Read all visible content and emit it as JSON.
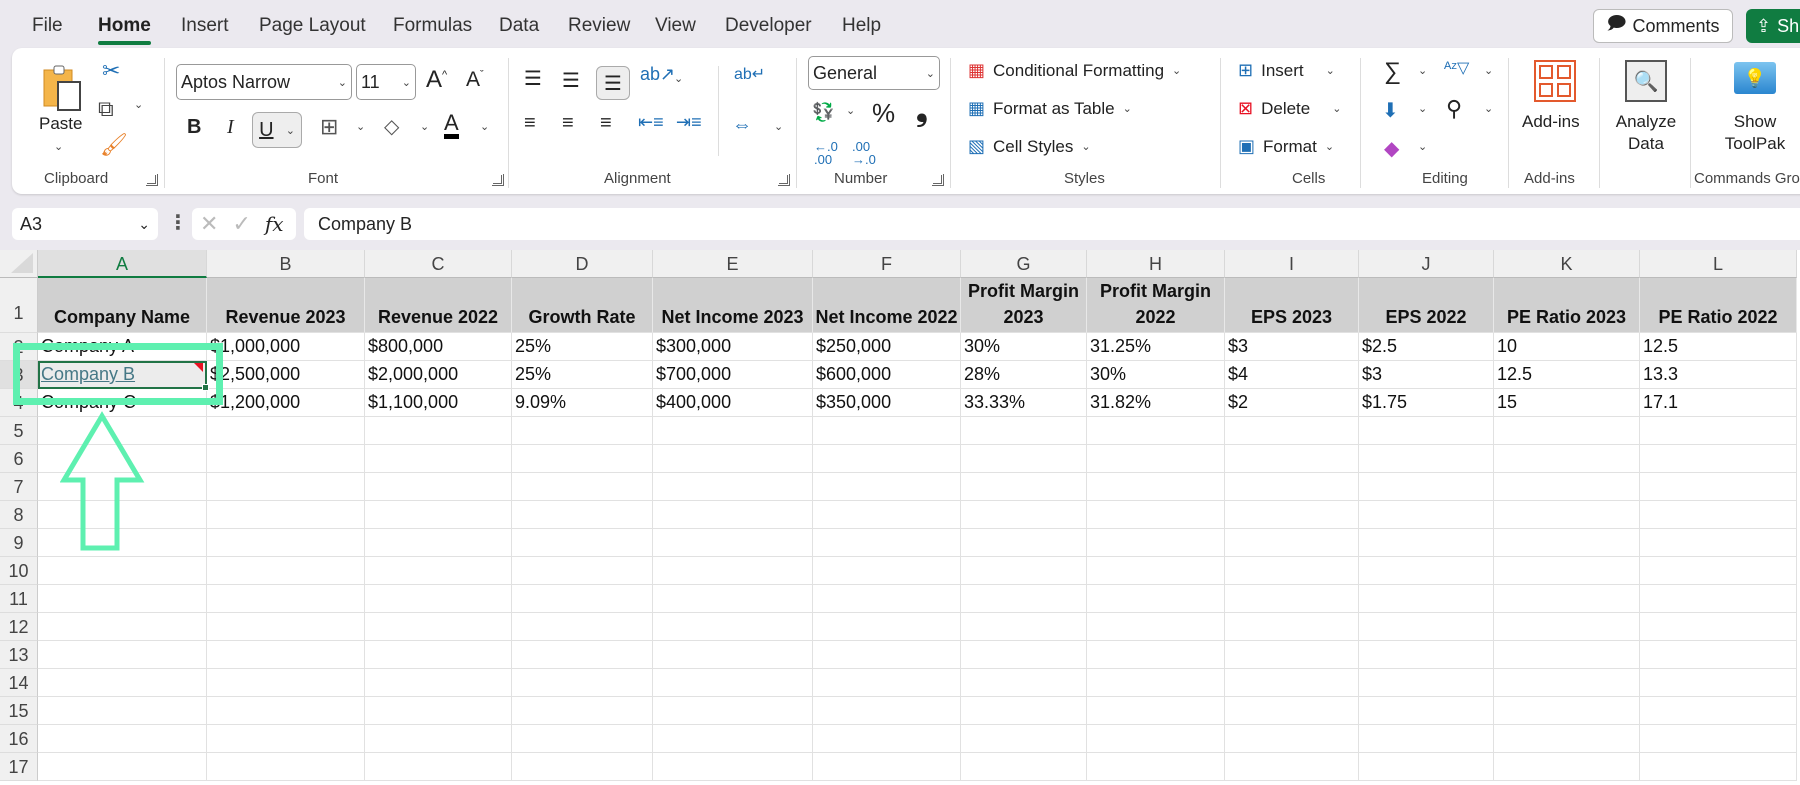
{
  "menubar": {
    "tabs": [
      {
        "label": "File",
        "active": false
      },
      {
        "label": "Home",
        "active": true
      },
      {
        "label": "Insert",
        "active": false
      },
      {
        "label": "Page Layout",
        "active": false
      },
      {
        "label": "Formulas",
        "active": false
      },
      {
        "label": "Data",
        "active": false
      },
      {
        "label": "Review",
        "active": false
      },
      {
        "label": "View",
        "active": false
      },
      {
        "label": "Developer",
        "active": false
      },
      {
        "label": "Help",
        "active": false
      }
    ],
    "comments_label": "Comments",
    "share_label": "Sh",
    "accent_color": "#107c41"
  },
  "ribbon": {
    "clipboard": {
      "paste": "Paste",
      "label": "Clipboard"
    },
    "font": {
      "font_name": "Aptos Narrow",
      "font_size": "11",
      "bold": "B",
      "italic": "I",
      "underline": "U",
      "label": "Font"
    },
    "alignment": {
      "label": "Alignment"
    },
    "number": {
      "format": "General",
      "percent": "%",
      "comma": "❟",
      "label": "Number"
    },
    "styles": {
      "conditional": "Conditional Formatting",
      "format_table": "Format as Table",
      "cell_styles": "Cell Styles",
      "label": "Styles"
    },
    "cells": {
      "insert": "Insert",
      "delete": "Delete",
      "format": "Format",
      "label": "Cells"
    },
    "editing": {
      "label": "Editing"
    },
    "addins": {
      "button": "Add-ins",
      "label": "Add-ins"
    },
    "analyze": {
      "line1": "Analyze",
      "line2": "Data"
    },
    "toolpak": {
      "line1": "Show",
      "line2": "ToolPak",
      "label": "Commands Gro"
    }
  },
  "formula_bar": {
    "name_box": "A3",
    "value": "Company B",
    "fx": "fx"
  },
  "sheet": {
    "columns": [
      "A",
      "B",
      "C",
      "D",
      "E",
      "F",
      "G",
      "H",
      "I",
      "J",
      "K",
      "L"
    ],
    "selected_column": "A",
    "rows": [
      "1",
      "2",
      "3",
      "4",
      "5",
      "6",
      "7",
      "8",
      "9",
      "10",
      "11",
      "12",
      "13",
      "14",
      "15",
      "16",
      "17"
    ],
    "selected_row": "3",
    "active_cell": "A3",
    "headers": [
      "Company Name",
      "Revenue 2023",
      "Revenue 2022",
      "Growth Rate",
      "Net Income 2023",
      "Net Income 2022",
      "Profit Margin 2023",
      "Profit Margin 2022",
      "EPS 2023",
      "EPS 2022",
      "PE Ratio 2023",
      "PE Ratio 2022"
    ],
    "data": [
      [
        "Company A",
        "$1,000,000",
        "$800,000",
        "25%",
        "$300,000",
        "$250,000",
        "30%",
        "31.25%",
        "$3",
        "$2.5",
        "10",
        "12.5"
      ],
      [
        "Company B",
        "$2,500,000",
        "$2,000,000",
        "25%",
        "$700,000",
        "$600,000",
        "28%",
        "30%",
        "$4",
        "$3",
        "12.5",
        "13.3"
      ],
      [
        "Company C",
        "$1,200,000",
        "$1,100,000",
        "9.09%",
        "$400,000",
        "$350,000",
        "33.33%",
        "31.82%",
        "$2",
        "$1.75",
        "15",
        "17.1"
      ]
    ]
  },
  "annotation": {
    "color": "#5ef0b0",
    "target": "A3"
  }
}
